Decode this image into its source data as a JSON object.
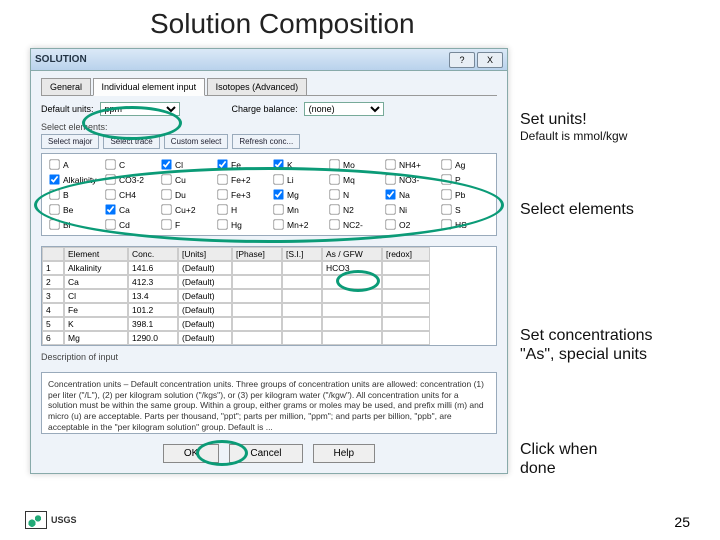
{
  "slide": {
    "title": "Solution Composition",
    "pagenum": "25",
    "logo_text": "USGS"
  },
  "callouts": {
    "units_title": "Set units!",
    "units_sub": "Default is mmol/kgw",
    "elements": "Select elements",
    "conc_l1": "Set concentrations",
    "conc_l2": "\"As\", special units",
    "done_l1": "Click when",
    "done_l2": "done"
  },
  "dialog": {
    "title": "SOLUTION",
    "help_btn": "?",
    "close_btn": "X",
    "tabs": {
      "general": "General",
      "indiv": "Individual element input",
      "iso": "Isotopes (Advanced)"
    },
    "units_label": "Default units:",
    "units_value": "ppm",
    "charge_label": "Charge balance:",
    "charge_value": "(none)",
    "select_hdr": "Select elements:",
    "toolbar": {
      "select_major": "Select major",
      "select_trace": "Select trace",
      "custom": "Custom select",
      "refresh": "Refresh conc..."
    },
    "elements": [
      {
        "n": "A",
        "c": false
      },
      {
        "n": "C",
        "c": false
      },
      {
        "n": "Cl",
        "c": true
      },
      {
        "n": "Fe",
        "c": true
      },
      {
        "n": "K",
        "c": true
      },
      {
        "n": "Mo",
        "c": false
      },
      {
        "n": "NH4+",
        "c": false
      },
      {
        "n": "Ag",
        "c": false
      },
      {
        "n": "Alkalinity",
        "c": true
      },
      {
        "n": "CO3-2",
        "c": false
      },
      {
        "n": "Cu",
        "c": false
      },
      {
        "n": "Fe+2",
        "c": false
      },
      {
        "n": "Li",
        "c": false
      },
      {
        "n": "Mq",
        "c": false
      },
      {
        "n": "NO3-",
        "c": false
      },
      {
        "n": "P",
        "c": false
      },
      {
        "n": "B",
        "c": false
      },
      {
        "n": "CH4",
        "c": false
      },
      {
        "n": "Du",
        "c": false
      },
      {
        "n": "Fe+3",
        "c": false
      },
      {
        "n": "Mg",
        "c": true
      },
      {
        "n": "N",
        "c": false
      },
      {
        "n": "Na",
        "c": true
      },
      {
        "n": "Pb",
        "c": false
      },
      {
        "n": "Be",
        "c": false
      },
      {
        "n": "Ca",
        "c": true
      },
      {
        "n": "Cu+2",
        "c": false
      },
      {
        "n": "H",
        "c": false
      },
      {
        "n": "Mn",
        "c": false
      },
      {
        "n": "N2",
        "c": false
      },
      {
        "n": "Ni",
        "c": false
      },
      {
        "n": "S",
        "c": false
      },
      {
        "n": "Bi",
        "c": false
      },
      {
        "n": "Cd",
        "c": false
      },
      {
        "n": "F",
        "c": false
      },
      {
        "n": "Hg",
        "c": false
      },
      {
        "n": "Mn+2",
        "c": false
      },
      {
        "n": "NC2-",
        "c": false
      },
      {
        "n": "O2",
        "c": false
      },
      {
        "n": "HS",
        "c": false
      }
    ],
    "cols": {
      "idx": "",
      "el": "Element",
      "conc": "Conc.",
      "units": "[Units]",
      "phase": "[Phase]",
      "si": "[S.I.]",
      "as": "As / GFW",
      "redox": "[redox]"
    },
    "rows": [
      {
        "i": "1",
        "el": "Alkalinity",
        "conc": "141.6",
        "u": "(Default)",
        "as": "HCO3"
      },
      {
        "i": "2",
        "el": "Ca",
        "conc": "412.3",
        "u": "(Default)",
        "as": ""
      },
      {
        "i": "3",
        "el": "Cl",
        "conc": "13.4",
        "u": "(Default)",
        "as": ""
      },
      {
        "i": "4",
        "el": "Fe",
        "conc": "101.2",
        "u": "(Default)",
        "as": ""
      },
      {
        "i": "5",
        "el": "K",
        "conc": "398.1",
        "u": "(Default)",
        "as": ""
      },
      {
        "i": "6",
        "el": "Mg",
        "conc": "1290.0",
        "u": "(Default)",
        "as": ""
      }
    ],
    "desc_hdr": "Description of input",
    "desc_text": "Concentration units – Default concentration units. Three groups of concentration units are allowed: concentration (1) per liter (\"/L\"), (2) per kilogram solution (\"/kgs\"), or (3) per kilogram water (\"/kgw\"). All concentration units for a solution must be within the same group. Within a group, either grams or moles may be used, and prefix milli (m) and micro (u) are acceptable. Parts per thousand, \"ppt\"; parts per million, \"ppm\"; and parts per billion, \"ppb\", are acceptable in the \"per kilogram solution\" group. Default is ...",
    "buttons": {
      "ok": "OK",
      "cancel": "Cancel",
      "help": "Help"
    }
  }
}
